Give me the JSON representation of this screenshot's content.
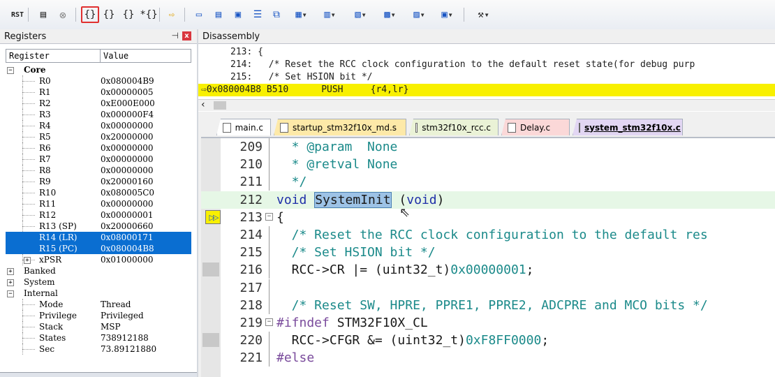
{
  "toolbar": {
    "items": [
      {
        "icon": "reset-icon",
        "label": "RST"
      },
      {
        "icon": "run-icon",
        "label": "▤"
      },
      {
        "icon": "stop-icon",
        "label": "⊗"
      },
      {
        "icon": "step-in-icon",
        "label": "{}"
      },
      {
        "icon": "step-over-icon",
        "label": "{}"
      },
      {
        "icon": "step-out-icon",
        "label": "{}"
      },
      {
        "icon": "run-to-cursor-icon",
        "label": "*{}"
      },
      {
        "icon": "show-next-statement-icon",
        "label": "⇨"
      },
      {
        "icon": "command-window-icon",
        "label": "▭"
      },
      {
        "icon": "disassembly-window-icon",
        "label": "▤"
      },
      {
        "icon": "symbols-window-icon",
        "label": "▣"
      },
      {
        "icon": "registers-window-icon",
        "label": "☰"
      },
      {
        "icon": "call-stack-window-icon",
        "label": "⧉"
      },
      {
        "icon": "watch-window-icon",
        "label": "▦"
      },
      {
        "icon": "memory-window-icon",
        "label": "▥"
      },
      {
        "icon": "serial-window-icon",
        "label": "▧"
      },
      {
        "icon": "analysis-window-icon",
        "label": "▩"
      },
      {
        "icon": "trace-window-icon",
        "label": "▨"
      },
      {
        "icon": "system-viewer-icon",
        "label": "▣"
      },
      {
        "icon": "toolbox-icon",
        "label": "⚒"
      }
    ],
    "selected_item": "step-in-icon"
  },
  "registers": {
    "title": "Registers",
    "col_register": "Register",
    "col_value": "Value",
    "rows": [
      {
        "name": "Core",
        "value": "",
        "level": 0,
        "expander": "−",
        "bold": true
      },
      {
        "name": "R0",
        "value": "0x080004B9",
        "level": 1
      },
      {
        "name": "R1",
        "value": "0x00000005",
        "level": 1
      },
      {
        "name": "R2",
        "value": "0xE000E000",
        "level": 1
      },
      {
        "name": "R3",
        "value": "0x000000F4",
        "level": 1
      },
      {
        "name": "R4",
        "value": "0x00000000",
        "level": 1
      },
      {
        "name": "R5",
        "value": "0x20000000",
        "level": 1
      },
      {
        "name": "R6",
        "value": "0x00000000",
        "level": 1
      },
      {
        "name": "R7",
        "value": "0x00000000",
        "level": 1
      },
      {
        "name": "R8",
        "value": "0x00000000",
        "level": 1
      },
      {
        "name": "R9",
        "value": "0x20000160",
        "level": 1
      },
      {
        "name": "R10",
        "value": "0x080005C0",
        "level": 1
      },
      {
        "name": "R11",
        "value": "0x00000000",
        "level": 1
      },
      {
        "name": "R12",
        "value": "0x00000001",
        "level": 1
      },
      {
        "name": "R13 (SP)",
        "value": "0x20000660",
        "level": 1
      },
      {
        "name": "R14 (LR)",
        "value": "0x08000171",
        "level": 1,
        "highlight": true
      },
      {
        "name": "R15 (PC)",
        "value": "0x080004B8",
        "level": 1,
        "highlight": true
      },
      {
        "name": "xPSR",
        "value": "0x01000000",
        "level": 1,
        "expander": "+"
      },
      {
        "name": "Banked",
        "value": "",
        "level": 0,
        "expander": "+"
      },
      {
        "name": "System",
        "value": "",
        "level": 0,
        "expander": "+"
      },
      {
        "name": "Internal",
        "value": "",
        "level": 0,
        "expander": "−"
      },
      {
        "name": "Mode",
        "value": "Thread",
        "level": 1
      },
      {
        "name": "Privilege",
        "value": "Privileged",
        "level": 1
      },
      {
        "name": "Stack",
        "value": "MSP",
        "level": 1
      },
      {
        "name": "States",
        "value": "738912188",
        "level": 1
      },
      {
        "name": "Sec",
        "value": "73.89121880",
        "level": 1
      }
    ]
  },
  "disassembly": {
    "title": "Disassembly",
    "lines": [
      {
        "text": "213: {",
        "current": false
      },
      {
        "text": "214:   /* Reset the RCC clock configuration to the default reset state(for debug purp",
        "current": false
      },
      {
        "text": "215:   /* Set HSION bit */",
        "current": false
      },
      {
        "text": "0x080004B8 B510      PUSH     {r4,lr}",
        "current": true
      }
    ]
  },
  "editor_tabs": [
    {
      "label": "main.c",
      "color": "#ffffff",
      "active": false
    },
    {
      "label": "startup_stm32f10x_md.s",
      "color": "#fde9a8",
      "active": false
    },
    {
      "label": "stm32f10x_rcc.c",
      "color": "#eaf2d6",
      "active": false
    },
    {
      "label": "Delay.c",
      "color": "#fbd8d8",
      "active": false
    },
    {
      "label": "system_stm32f10x.c",
      "color": "#e2d6f3",
      "active": true
    }
  ],
  "code": {
    "lines": [
      {
        "num": "209",
        "parts": [
          {
            "t": "  * @param  None",
            "c": "cmt"
          }
        ]
      },
      {
        "num": "210",
        "parts": [
          {
            "t": "  * @retval None",
            "c": "cmt"
          }
        ]
      },
      {
        "num": "211",
        "parts": [
          {
            "t": "  */",
            "c": "cmt"
          }
        ]
      },
      {
        "num": "212",
        "parts": [
          {
            "t": "void ",
            "c": "kw"
          },
          {
            "t": "SystemInit",
            "c": "selword"
          },
          {
            "t": " (",
            "c": ""
          },
          {
            "t": "void",
            "c": "kw"
          },
          {
            "t": ")",
            "c": ""
          }
        ],
        "highlight": true
      },
      {
        "num": "213",
        "fold": "−",
        "parts": [
          {
            "t": "{",
            "c": ""
          }
        ],
        "pointer": true
      },
      {
        "num": "214",
        "parts": [
          {
            "t": "  /* Reset the RCC clock configuration to the default res",
            "c": "cmt"
          }
        ]
      },
      {
        "num": "215",
        "parts": [
          {
            "t": "  /* Set HSION bit */",
            "c": "cmt"
          }
        ]
      },
      {
        "num": "216",
        "parts": [
          {
            "t": "  RCC->CR |= (uint32_t)",
            "c": ""
          },
          {
            "t": "0x00000001",
            "c": "num"
          },
          {
            "t": ";",
            "c": ""
          }
        ],
        "breakpoint_area": true
      },
      {
        "num": "217",
        "parts": []
      },
      {
        "num": "218",
        "parts": [
          {
            "t": "  /* Reset SW, HPRE, PPRE1, PPRE2, ADCPRE and MCO bits */",
            "c": "cmt"
          }
        ]
      },
      {
        "num": "219",
        "fold": "−",
        "parts": [
          {
            "t": "#ifndef ",
            "c": "pp"
          },
          {
            "t": "STM32F10X_CL",
            "c": ""
          }
        ]
      },
      {
        "num": "220",
        "parts": [
          {
            "t": "  RCC->CFGR &= (uint32_t)",
            "c": ""
          },
          {
            "t": "0xF8FF0000",
            "c": "num"
          },
          {
            "t": ";",
            "c": ""
          }
        ],
        "breakpoint_area": true
      },
      {
        "num": "221",
        "parts": [
          {
            "t": "#else",
            "c": "pp"
          }
        ]
      }
    ]
  },
  "colors": {
    "current_line_yellow": "#f8f000",
    "selection_blue": "#0a6ed1",
    "comment_teal": "#1b8a8a",
    "keyword_blue": "#1f2fa8"
  }
}
